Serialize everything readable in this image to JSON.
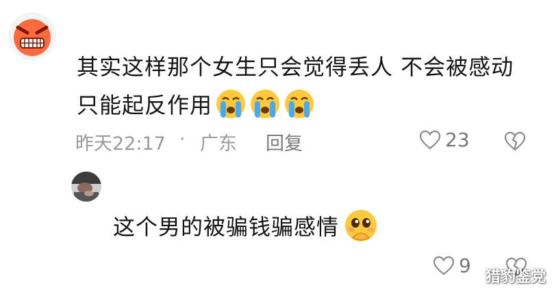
{
  "comment1": {
    "text_part1": "其实这样那个女生只会觉得丢人 不会被感动 只能起反作用",
    "time": "昨天22:17",
    "separator": "·",
    "location": "广东",
    "reply_label": "回复",
    "likes": "23",
    "emoji_icon": "crying-face-icon"
  },
  "comment2": {
    "text": "这个男的被骗钱骗感情",
    "likes": "9",
    "emoji_icon": "pleading-face-icon"
  },
  "watermark": "猎豹鉴党"
}
